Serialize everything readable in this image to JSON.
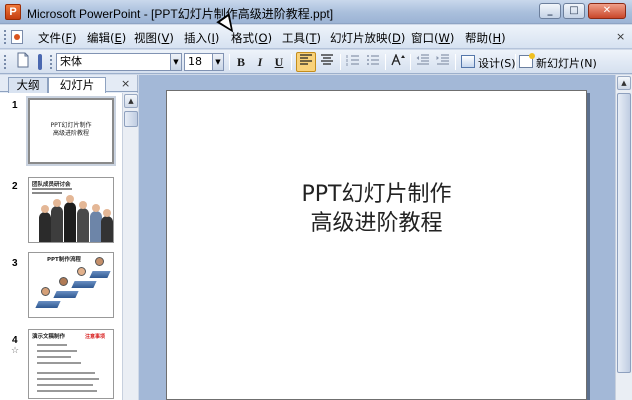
{
  "window": {
    "title": "Microsoft PowerPoint - [PPT幻灯片制作高级进阶教程.ppt]",
    "app_icon_letter": "P",
    "minimize": "_",
    "maximize": "□",
    "close": "✕"
  },
  "menu": {
    "items": [
      {
        "label": "文件(",
        "key": "F",
        "end": ")"
      },
      {
        "label": "编辑(",
        "key": "E",
        "end": ")"
      },
      {
        "label": "视图(",
        "key": "V",
        "end": ")"
      },
      {
        "label": "插入(",
        "key": "I",
        "end": ")"
      },
      {
        "label": "格式(",
        "key": "O",
        "end": ")"
      },
      {
        "label": "工具(",
        "key": "T",
        "end": ")"
      },
      {
        "label": "幻灯片放映(",
        "key": "D",
        "end": ")"
      },
      {
        "label": "窗口(",
        "key": "W",
        "end": ")"
      },
      {
        "label": "帮助(",
        "key": "H",
        "end": ")"
      }
    ],
    "help_close": "×"
  },
  "toolbar": {
    "font_name": "宋体",
    "font_size": "18",
    "bold": "B",
    "italic": "I",
    "underline": "U",
    "design_label": "设计(S)",
    "new_slide_label": "新幻灯片(N)"
  },
  "left_pane": {
    "tabs": [
      "大纲",
      "幻灯片"
    ],
    "close": "×",
    "slides": [
      {
        "number": "1",
        "lines": [
          "PPT幻灯片制作",
          "高级进阶教程"
        ]
      },
      {
        "number": "2",
        "heading": "团队成员研讨会"
      },
      {
        "number": "3",
        "heading": "PPT制作流程"
      },
      {
        "number": "4",
        "heading": "演示文稿制作",
        "red": "注意事项"
      }
    ]
  },
  "slide": {
    "title_line1": "PPT幻灯片制作",
    "title_line2": "高级进阶教程"
  }
}
